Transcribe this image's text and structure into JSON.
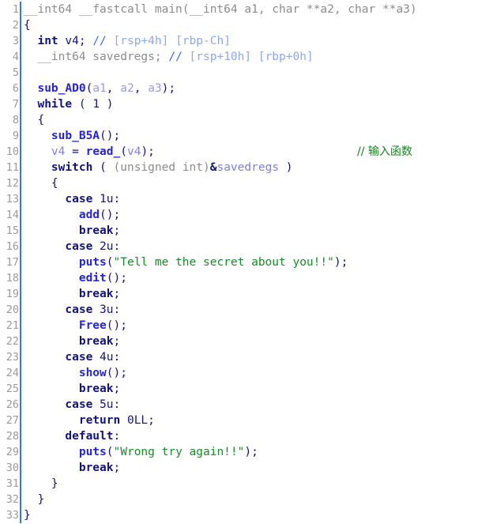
{
  "view": {
    "name": "ida-pseudocode-view",
    "background": "#ffffff",
    "gutter_divider_color": "#2f7fc4",
    "total_lines": 33
  },
  "colors": {
    "default": "#13137a",
    "keyword": "#13137a",
    "gray_type": "#8c8c8c",
    "function": "#2424d8",
    "variable": "#8080e0",
    "comment_blue": "#3c6ce8",
    "comment_blue_light": "#8fa8ee",
    "string_green": "#178c28",
    "cjk_comment_green": "#14861f",
    "line_number": "#9a9a9a"
  },
  "code": [
    {
      "num": "1",
      "indent": 0,
      "tokens": [
        {
          "t": "gray",
          "s": "__int64 __fastcall main(__int64 a1, char **a2, char **a3)"
        }
      ]
    },
    {
      "num": "2",
      "indent": 0,
      "tokens": [
        {
          "t": "default",
          "s": "{"
        }
      ]
    },
    {
      "num": "3",
      "indent": 1,
      "tokens": [
        {
          "t": "type",
          "s": "int"
        },
        {
          "t": "default",
          "s": " v4; "
        },
        {
          "t": "comment",
          "s": "// "
        },
        {
          "t": "commentlt",
          "s": "[rsp+4h] [rbp-Ch]"
        }
      ]
    },
    {
      "num": "4",
      "indent": 1,
      "tokens": [
        {
          "t": "gray",
          "s": "__int64 savedregs; "
        },
        {
          "t": "comment",
          "s": "// "
        },
        {
          "t": "commentlt",
          "s": "[rsp+10h] [rbp+0h]"
        }
      ]
    },
    {
      "num": "5",
      "indent": 0,
      "tokens": []
    },
    {
      "num": "6",
      "indent": 1,
      "tokens": [
        {
          "t": "func",
          "s": "sub_AD0"
        },
        {
          "t": "default",
          "s": "("
        },
        {
          "t": "arg",
          "s": "a1"
        },
        {
          "t": "default",
          "s": ", "
        },
        {
          "t": "arg",
          "s": "a2"
        },
        {
          "t": "default",
          "s": ", "
        },
        {
          "t": "arg",
          "s": "a3"
        },
        {
          "t": "default",
          "s": ");"
        }
      ]
    },
    {
      "num": "7",
      "indent": 1,
      "tokens": [
        {
          "t": "keyword",
          "s": "while"
        },
        {
          "t": "default",
          "s": " ( 1 )"
        }
      ]
    },
    {
      "num": "8",
      "indent": 1,
      "tokens": [
        {
          "t": "default",
          "s": "{"
        }
      ]
    },
    {
      "num": "9",
      "indent": 2,
      "tokens": [
        {
          "t": "func",
          "s": "sub_B5A"
        },
        {
          "t": "default",
          "s": "();"
        }
      ]
    },
    {
      "num": "10",
      "indent": 2,
      "tokens": [
        {
          "t": "var",
          "s": "v4"
        },
        {
          "t": "default",
          "s": " = "
        },
        {
          "t": "func",
          "s": "read_"
        },
        {
          "t": "default",
          "s": "("
        },
        {
          "t": "var",
          "s": "v4"
        },
        {
          "t": "default",
          "s": ");"
        }
      ],
      "trailing_comment": "// 输入函数"
    },
    {
      "num": "11",
      "indent": 2,
      "tokens": [
        {
          "t": "keyword",
          "s": "switch"
        },
        {
          "t": "default",
          "s": " ( "
        },
        {
          "t": "gray",
          "s": "(unsigned int)"
        },
        {
          "t": "keyword",
          "s": "&"
        },
        {
          "t": "var",
          "s": "savedregs"
        },
        {
          "t": "default",
          "s": " )"
        }
      ]
    },
    {
      "num": "12",
      "indent": 2,
      "tokens": [
        {
          "t": "default",
          "s": "{"
        }
      ]
    },
    {
      "num": "13",
      "indent": 3,
      "tokens": [
        {
          "t": "keyword",
          "s": "case"
        },
        {
          "t": "default",
          "s": " 1u:"
        }
      ]
    },
    {
      "num": "14",
      "indent": 4,
      "tokens": [
        {
          "t": "func",
          "s": "add"
        },
        {
          "t": "default",
          "s": "();"
        }
      ]
    },
    {
      "num": "15",
      "indent": 4,
      "tokens": [
        {
          "t": "keyword",
          "s": "break"
        },
        {
          "t": "default",
          "s": ";"
        }
      ]
    },
    {
      "num": "16",
      "indent": 3,
      "tokens": [
        {
          "t": "keyword",
          "s": "case"
        },
        {
          "t": "default",
          "s": " 2u:"
        }
      ]
    },
    {
      "num": "17",
      "indent": 4,
      "tokens": [
        {
          "t": "func",
          "s": "puts"
        },
        {
          "t": "default",
          "s": "("
        },
        {
          "t": "string",
          "s": "\"Tell me the secret about you!!\""
        },
        {
          "t": "default",
          "s": ");"
        }
      ]
    },
    {
      "num": "18",
      "indent": 4,
      "tokens": [
        {
          "t": "func",
          "s": "edit"
        },
        {
          "t": "default",
          "s": "();"
        }
      ]
    },
    {
      "num": "19",
      "indent": 4,
      "tokens": [
        {
          "t": "keyword",
          "s": "break"
        },
        {
          "t": "default",
          "s": ";"
        }
      ]
    },
    {
      "num": "20",
      "indent": 3,
      "tokens": [
        {
          "t": "keyword",
          "s": "case"
        },
        {
          "t": "default",
          "s": " 3u:"
        }
      ]
    },
    {
      "num": "21",
      "indent": 4,
      "tokens": [
        {
          "t": "func",
          "s": "Free"
        },
        {
          "t": "default",
          "s": "();"
        }
      ]
    },
    {
      "num": "22",
      "indent": 4,
      "tokens": [
        {
          "t": "keyword",
          "s": "break"
        },
        {
          "t": "default",
          "s": ";"
        }
      ]
    },
    {
      "num": "23",
      "indent": 3,
      "tokens": [
        {
          "t": "keyword",
          "s": "case"
        },
        {
          "t": "default",
          "s": " 4u:"
        }
      ]
    },
    {
      "num": "24",
      "indent": 4,
      "tokens": [
        {
          "t": "func",
          "s": "show"
        },
        {
          "t": "default",
          "s": "();"
        }
      ]
    },
    {
      "num": "25",
      "indent": 4,
      "tokens": [
        {
          "t": "keyword",
          "s": "break"
        },
        {
          "t": "default",
          "s": ";"
        }
      ]
    },
    {
      "num": "26",
      "indent": 3,
      "tokens": [
        {
          "t": "keyword",
          "s": "case"
        },
        {
          "t": "default",
          "s": " 5u:"
        }
      ]
    },
    {
      "num": "27",
      "indent": 4,
      "tokens": [
        {
          "t": "keyword",
          "s": "return"
        },
        {
          "t": "default",
          "s": " 0LL;"
        }
      ]
    },
    {
      "num": "28",
      "indent": 3,
      "tokens": [
        {
          "t": "keyword",
          "s": "default"
        },
        {
          "t": "default",
          "s": ":"
        }
      ]
    },
    {
      "num": "29",
      "indent": 4,
      "tokens": [
        {
          "t": "func",
          "s": "puts"
        },
        {
          "t": "default",
          "s": "("
        },
        {
          "t": "string",
          "s": "\"Wrong try again!!\""
        },
        {
          "t": "default",
          "s": ");"
        }
      ]
    },
    {
      "num": "30",
      "indent": 4,
      "tokens": [
        {
          "t": "keyword",
          "s": "break"
        },
        {
          "t": "default",
          "s": ";"
        }
      ]
    },
    {
      "num": "31",
      "indent": 2,
      "tokens": [
        {
          "t": "default",
          "s": "}"
        }
      ]
    },
    {
      "num": "32",
      "indent": 1,
      "tokens": [
        {
          "t": "default",
          "s": "}"
        }
      ]
    },
    {
      "num": "33",
      "indent": 0,
      "tokens": [
        {
          "t": "default",
          "s": "}"
        }
      ]
    }
  ]
}
